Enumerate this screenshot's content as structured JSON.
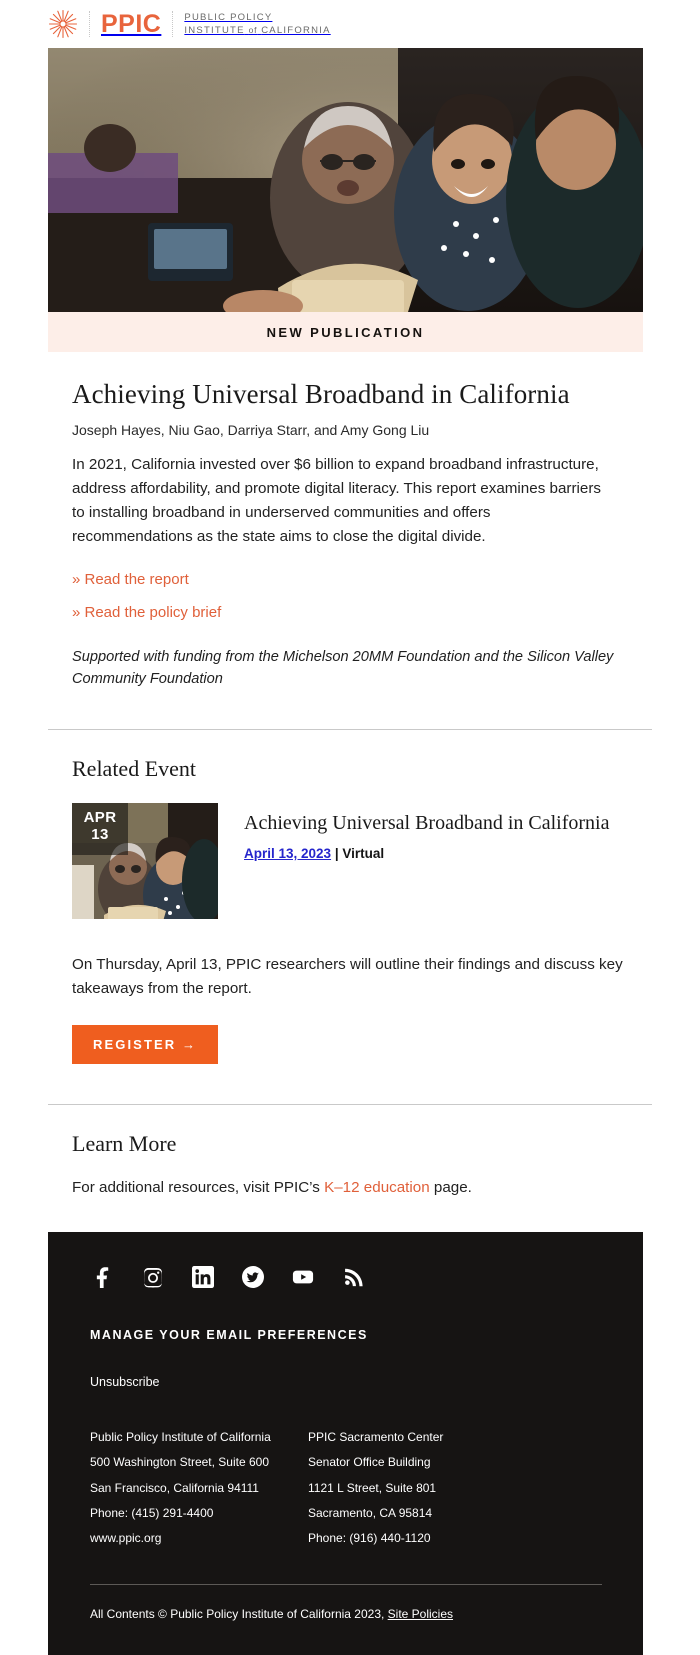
{
  "brand": {
    "name": "PPIC",
    "org_line1": "PUBLIC POLICY",
    "org_line2_a": "INSTITUTE",
    "org_line2_of": "of",
    "org_line2_b": "CALIFORNIA",
    "accent_orange": "#e8643c",
    "button_orange": "#ef5e1f",
    "band_bg": "#fdeee8",
    "footer_bg": "#161413",
    "link_blue": "#2525cc"
  },
  "banner": {
    "label": "NEW PUBLICATION"
  },
  "publication": {
    "title": "Achieving Universal Broadband in California",
    "authors": "Joseph Hayes, Niu Gao, Darriya Starr, and Amy Gong Liu",
    "summary": "In 2021, California invested over $6 billion to expand broadband infrastructure, address affordability, and promote digital literacy. This report examines barriers to installing broadband in underserved communities and offers recommendations as the state aims to close the digital divide.",
    "link_report": "» Read the report",
    "link_brief": "» Read the policy brief",
    "funding": "Supported with funding from the Michelson 20MM Foundation and the Silicon Valley Community Foundation"
  },
  "related_event": {
    "heading": "Related Event",
    "badge_month": "APR",
    "badge_day": "13",
    "title": "Achieving Universal Broadband in California",
    "date_link": "April 13, 2023",
    "separator": " | ",
    "format": "Virtual",
    "description": "On Thursday, April 13, PPIC researchers will outline their findings and discuss key takeaways from the report.",
    "register_label": "REGISTER →"
  },
  "learn_more": {
    "heading": "Learn More",
    "text_before": "For additional resources, visit PPIC’s ",
    "link": "K–12 education",
    "text_after": " page."
  },
  "footer": {
    "social": [
      {
        "name": "facebook-icon",
        "label": "Facebook"
      },
      {
        "name": "instagram-icon",
        "label": "Instagram"
      },
      {
        "name": "linkedin-icon",
        "label": "LinkedIn"
      },
      {
        "name": "twitter-icon",
        "label": "Twitter"
      },
      {
        "name": "youtube-icon",
        "label": "YouTube"
      },
      {
        "name": "rss-icon",
        "label": "RSS"
      }
    ],
    "manage_heading": "MANAGE YOUR EMAIL PREFERENCES",
    "unsubscribe": "Unsubscribe",
    "address_left": [
      "Public Policy Institute of California",
      "500 Washington Street, Suite 600",
      "San Francisco, California 94111",
      "Phone: (415) 291-4400",
      "www.ppic.org"
    ],
    "address_right": [
      "PPIC Sacramento Center",
      "Senator Office Building",
      "1121 L Street, Suite 801",
      "Sacramento, CA 95814",
      "Phone: (916) 440-1120"
    ],
    "copyright_text": "All Contents © Public Policy Institute of California 2023, ",
    "site_policies": "Site Policies"
  }
}
